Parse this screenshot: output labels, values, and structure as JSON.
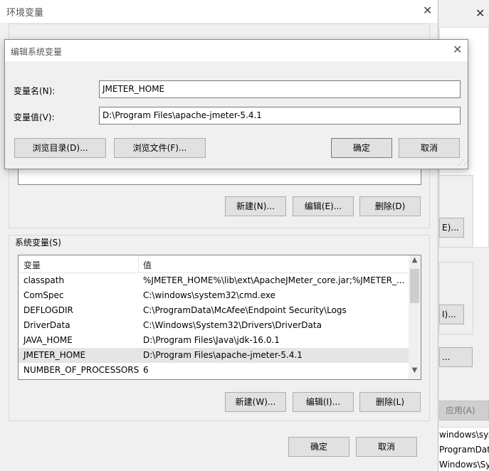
{
  "background_window": {
    "apply_label": "应用(A)",
    "list_lines": [
      "windows\\sys",
      "ProgramDat",
      "Windows\\Sys"
    ],
    "btn1_label": "E)...",
    "btn2_label": "I)...",
    "btn3_label": "..."
  },
  "env_dialog": {
    "title": "环境变量",
    "user_buttons": {
      "new": "新建(N)...",
      "edit": "编辑(E)...",
      "delete": "删除(D)"
    },
    "system_group_label": "系统变量(S)",
    "system_headers": {
      "name": "变量",
      "value": "值"
    },
    "system_variables": [
      {
        "name": "classpath",
        "value": "%JMETER_HOME%\\lib\\ext\\ApacheJMeter_core.jar;%JMETER_..."
      },
      {
        "name": "ComSpec",
        "value": "C:\\windows\\system32\\cmd.exe"
      },
      {
        "name": "DEFLOGDIR",
        "value": "C:\\ProgramData\\McAfee\\Endpoint Security\\Logs"
      },
      {
        "name": "DriverData",
        "value": "C:\\Windows\\System32\\Drivers\\DriverData"
      },
      {
        "name": "JAVA_HOME",
        "value": "D:\\Program Files\\Java\\jdk-16.0.1"
      },
      {
        "name": "JMETER_HOME",
        "value": "D:\\Program Files\\apache-jmeter-5.4.1"
      },
      {
        "name": "NUMBER_OF_PROCESSORS",
        "value": "6"
      }
    ],
    "selected_variable": "JMETER_HOME",
    "system_buttons": {
      "new": "新建(W)...",
      "edit": "编辑(I)...",
      "delete": "删除(L)"
    },
    "ok_label": "确定",
    "cancel_label": "取消"
  },
  "edit_dialog": {
    "title": "编辑系统变量",
    "name_label": "变量名(N):",
    "name_value": "JMETER_HOME",
    "value_label": "变量值(V):",
    "value_value": "D:\\Program Files\\apache-jmeter-5.4.1",
    "browse_dir_label": "浏览目录(D)...",
    "browse_file_label": "浏览文件(F)...",
    "ok_label": "确定",
    "cancel_label": "取消"
  }
}
